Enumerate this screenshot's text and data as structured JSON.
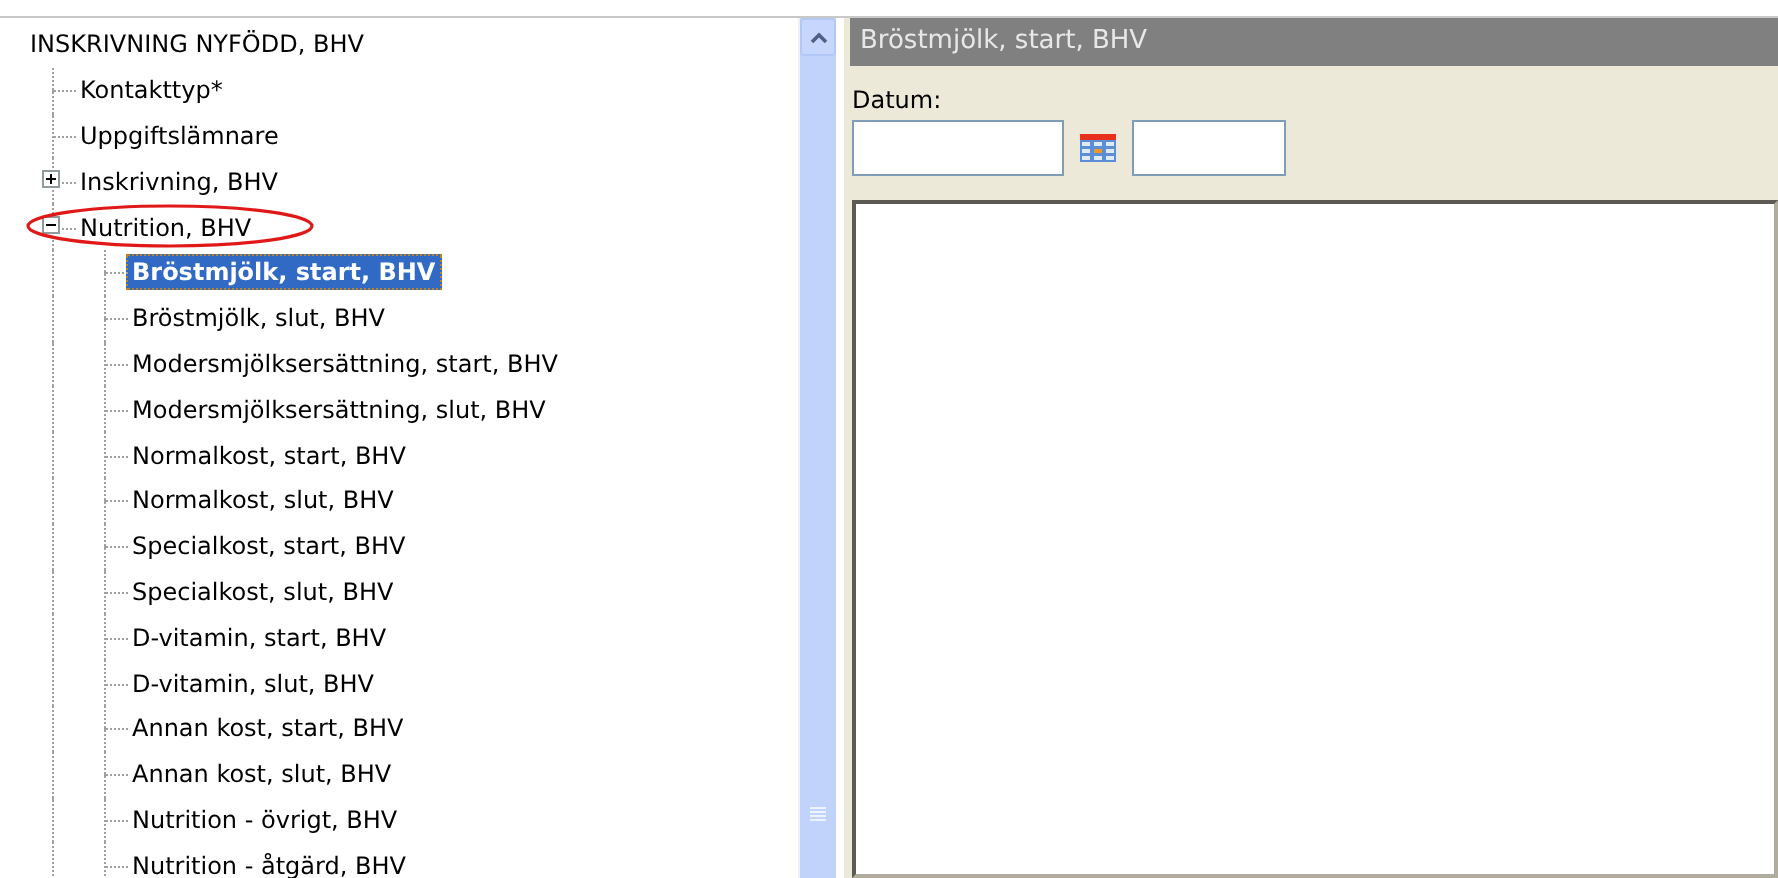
{
  "tree": {
    "label": "INSKRIVNING NYFÖDD, BHV",
    "selected": false,
    "children": [
      {
        "label": "Kontakttyp*",
        "selected": false
      },
      {
        "label": "Uppgiftslämnare",
        "selected": false
      },
      {
        "label": "Inskrivning, BHV",
        "selected": false,
        "expanded": false
      },
      {
        "label": "Nutrition, BHV",
        "selected": false,
        "expanded": true,
        "circled": true,
        "children": [
          {
            "label": "Bröstmjölk, start, BHV",
            "selected": true
          },
          {
            "label": "Bröstmjölk, slut, BHV",
            "selected": false
          },
          {
            "label": "Modersmjölksersättning, start, BHV",
            "selected": false
          },
          {
            "label": "Modersmjölksersättning, slut, BHV",
            "selected": false
          },
          {
            "label": "Normalkost, start, BHV",
            "selected": false
          },
          {
            "label": "Normalkost, slut, BHV",
            "selected": false
          },
          {
            "label": "Specialkost, start, BHV",
            "selected": false
          },
          {
            "label": "Specialkost, slut, BHV",
            "selected": false
          },
          {
            "label": "D-vitamin, start, BHV",
            "selected": false
          },
          {
            "label": "D-vitamin, slut, BHV",
            "selected": false
          },
          {
            "label": "Annan kost, start, BHV",
            "selected": false
          },
          {
            "label": "Annan kost, slut, BHV",
            "selected": false
          },
          {
            "label": "Nutrition - övrigt, BHV",
            "selected": false
          },
          {
            "label": "Nutrition - åtgärd, BHV",
            "selected": false
          }
        ]
      }
    ]
  },
  "panel": {
    "title": "Bröstmjölk, start, BHV",
    "date_label": "Datum:"
  }
}
